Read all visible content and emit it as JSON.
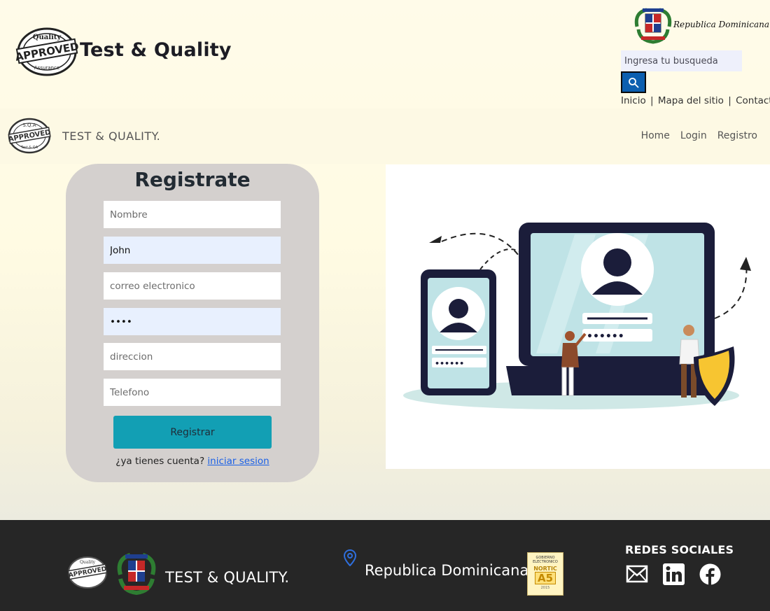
{
  "header": {
    "brand_title": "Test & Quality",
    "seal_icon": "approved-seal-icon",
    "gov_logo_icon": "coat-of-arms-icon",
    "gov_name": "Republica Dominicana",
    "search": {
      "placeholder": "Ingresa tu busqueda"
    },
    "top_links": [
      "Inicio",
      "Mapa del sitio",
      "Contacto"
    ],
    "search_button_color": "#0c5faf"
  },
  "navbar": {
    "brand": "TEST & QUALITY.",
    "links": [
      "Home",
      "Login",
      "Registro"
    ]
  },
  "register_form": {
    "title": "Registrate",
    "fields": {
      "nombre": {
        "placeholder": "Nombre",
        "value": ""
      },
      "apellido": {
        "value": "John"
      },
      "correo": {
        "placeholder": "correo electronico",
        "value": ""
      },
      "password": {
        "value": "••••"
      },
      "direccion": {
        "placeholder": "direccion",
        "value": ""
      },
      "telefono": {
        "placeholder": "Telefono",
        "value": ""
      }
    },
    "submit_label": "Registrar",
    "account_prompt": "¿ya tienes cuenta?",
    "login_link": "iniciar sesion",
    "button_color": "#129fb4",
    "card_color": "#d4d0ce"
  },
  "illustration": {
    "icon": "user-registration-illustration",
    "password_mask": "••••••"
  },
  "footer": {
    "brand": "TEST & QUALITY.",
    "country": "Republica Dominicana",
    "badge": {
      "top": "GOBIERNO ELECTRONICO",
      "name": "NORTIC",
      "code": "A5",
      "year": "2015"
    },
    "social_title": "REDES SOCIALES",
    "social_icons": [
      "mail-icon",
      "linkedin-icon",
      "facebook-icon"
    ],
    "background": "#262626"
  }
}
